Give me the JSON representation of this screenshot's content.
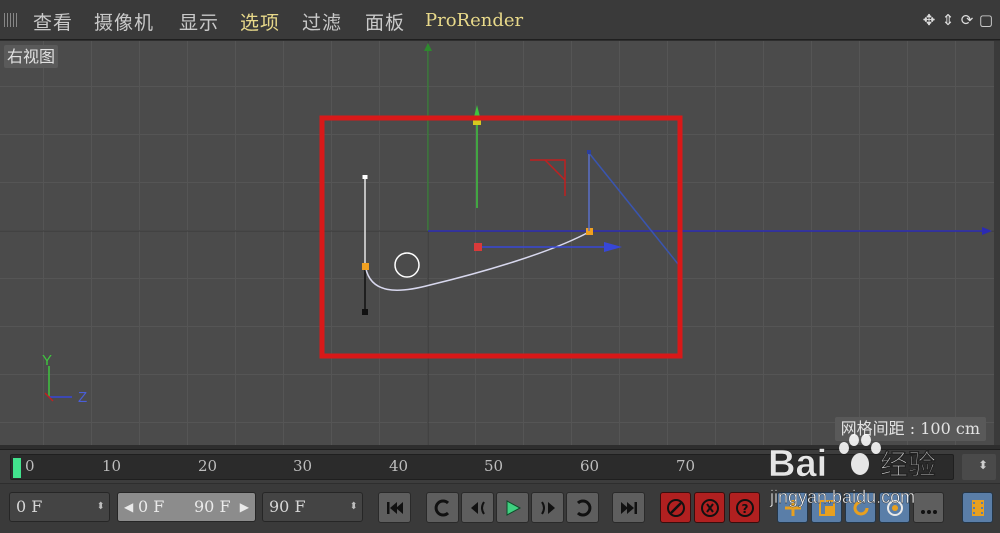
{
  "menubar": {
    "items": [
      "查看",
      "摄像机",
      "显示",
      "选项",
      "过滤",
      "面板",
      "ProRender"
    ],
    "highlighted": [
      "选项",
      "ProRender"
    ],
    "nav_icons": [
      "move-view-icon",
      "zoom-view-icon",
      "rotate-view-icon",
      "toggle-view-icon"
    ]
  },
  "viewport": {
    "label": "右视图",
    "grid_spacing": "网格间距 : 100 cm",
    "axis_labels": {
      "y": "Y",
      "z": "Z"
    },
    "selection_box_color": "#d91818"
  },
  "timeline": {
    "ticks": [
      "0",
      "10",
      "20",
      "30",
      "40",
      "50",
      "60",
      "70"
    ],
    "current_frame": 0
  },
  "transport": {
    "current_frame": "0 F",
    "range_start": "0 F",
    "range_end": "90 F",
    "end_frame": "90 F",
    "buttons": [
      "go-to-start",
      "previous-key",
      "previous-frame",
      "play",
      "next-frame",
      "next-key",
      "go-to-end"
    ],
    "record_buttons": [
      "record-icon",
      "autokey-icon",
      "help-icon"
    ],
    "accent": "#42e38d"
  },
  "watermark": {
    "brand": "Bai",
    "brand_cn": "经验",
    "url": "jingyan.baidu.com"
  }
}
